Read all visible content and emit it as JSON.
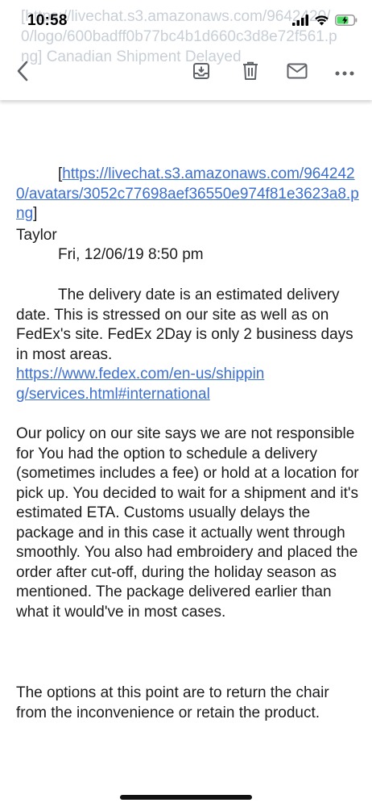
{
  "status_bar": {
    "time": "10:58"
  },
  "header": {
    "ghost_subject": "[https://livechat.s3.amazonaws.com/9642420/0/logo/600badff0b77bc4b1d660c3d8e72f561.png]  Canadian Shipment Delayed"
  },
  "toolbar": {
    "icons": [
      "back-chevron-icon",
      "archive-icon",
      "trash-icon",
      "mail-icon",
      "more-icon"
    ]
  },
  "message": {
    "avatar_open_bracket": "[",
    "avatar_url": "https://livechat.s3.amazonaws.com/9642420/avatars/3052c77698aef36550e974f81e3623a8.png",
    "avatar_close_bracket": "]",
    "author": "Taylor",
    "date": "Fri, 12/06/19 8:50 pm",
    "paragraph1": "The delivery date is an estimated delivery date. This is stressed on our site as well as on FedEx's site. FedEx 2Day is only 2 business days in most areas.",
    "paragraph1_link": "https://www.fedex.com/en-us/shipping/services.html#international",
    "paragraph2": "Our policy on our site says we are not responsible for You had the option to schedule a delivery (sometimes includes a fee) or hold at a location for pick up. You decided to wait for a shipment and it's estimated ETA. Customs usually delays the package and in this case it actually went through smoothly. You also had embroidery and placed the order after cut-off, during the holiday season as mentioned. The package delivered earlier than what it would've in most cases.",
    "paragraph3": "The options at this point are to return the chair from the inconvenience or retain the product."
  },
  "colors": {
    "link": "#3b6fd0",
    "ghost_text": "#c9cfd7",
    "icon": "#5f6368",
    "battery": "#4cd964"
  }
}
